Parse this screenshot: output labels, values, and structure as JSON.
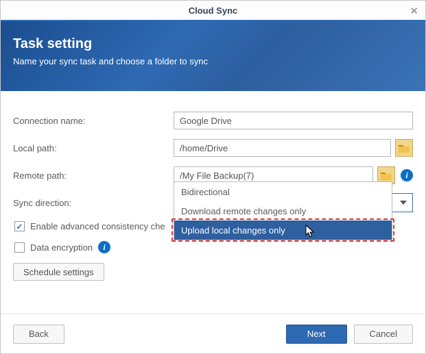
{
  "window": {
    "title": "Cloud Sync"
  },
  "header": {
    "title": "Task setting",
    "subtitle": "Name your sync task and choose a folder to sync"
  },
  "form": {
    "connection_name_label": "Connection name:",
    "connection_name_value": "Google Drive",
    "local_path_label": "Local path:",
    "local_path_value": "/home/Drive",
    "remote_path_label": "Remote path:",
    "remote_path_value": "/My File Backup(7)",
    "sync_direction_label": "Sync direction:",
    "sync_direction_value": "Bidirectional",
    "consistency_check_label": "Enable advanced consistency che",
    "data_encryption_label": "Data encryption",
    "schedule_settings_label": "Schedule settings"
  },
  "dropdown": {
    "options": [
      "Bidirectional",
      "Download remote changes only",
      "Upload local changes only"
    ],
    "highlighted_index": 2
  },
  "footer": {
    "back": "Back",
    "next": "Next",
    "cancel": "Cancel"
  }
}
